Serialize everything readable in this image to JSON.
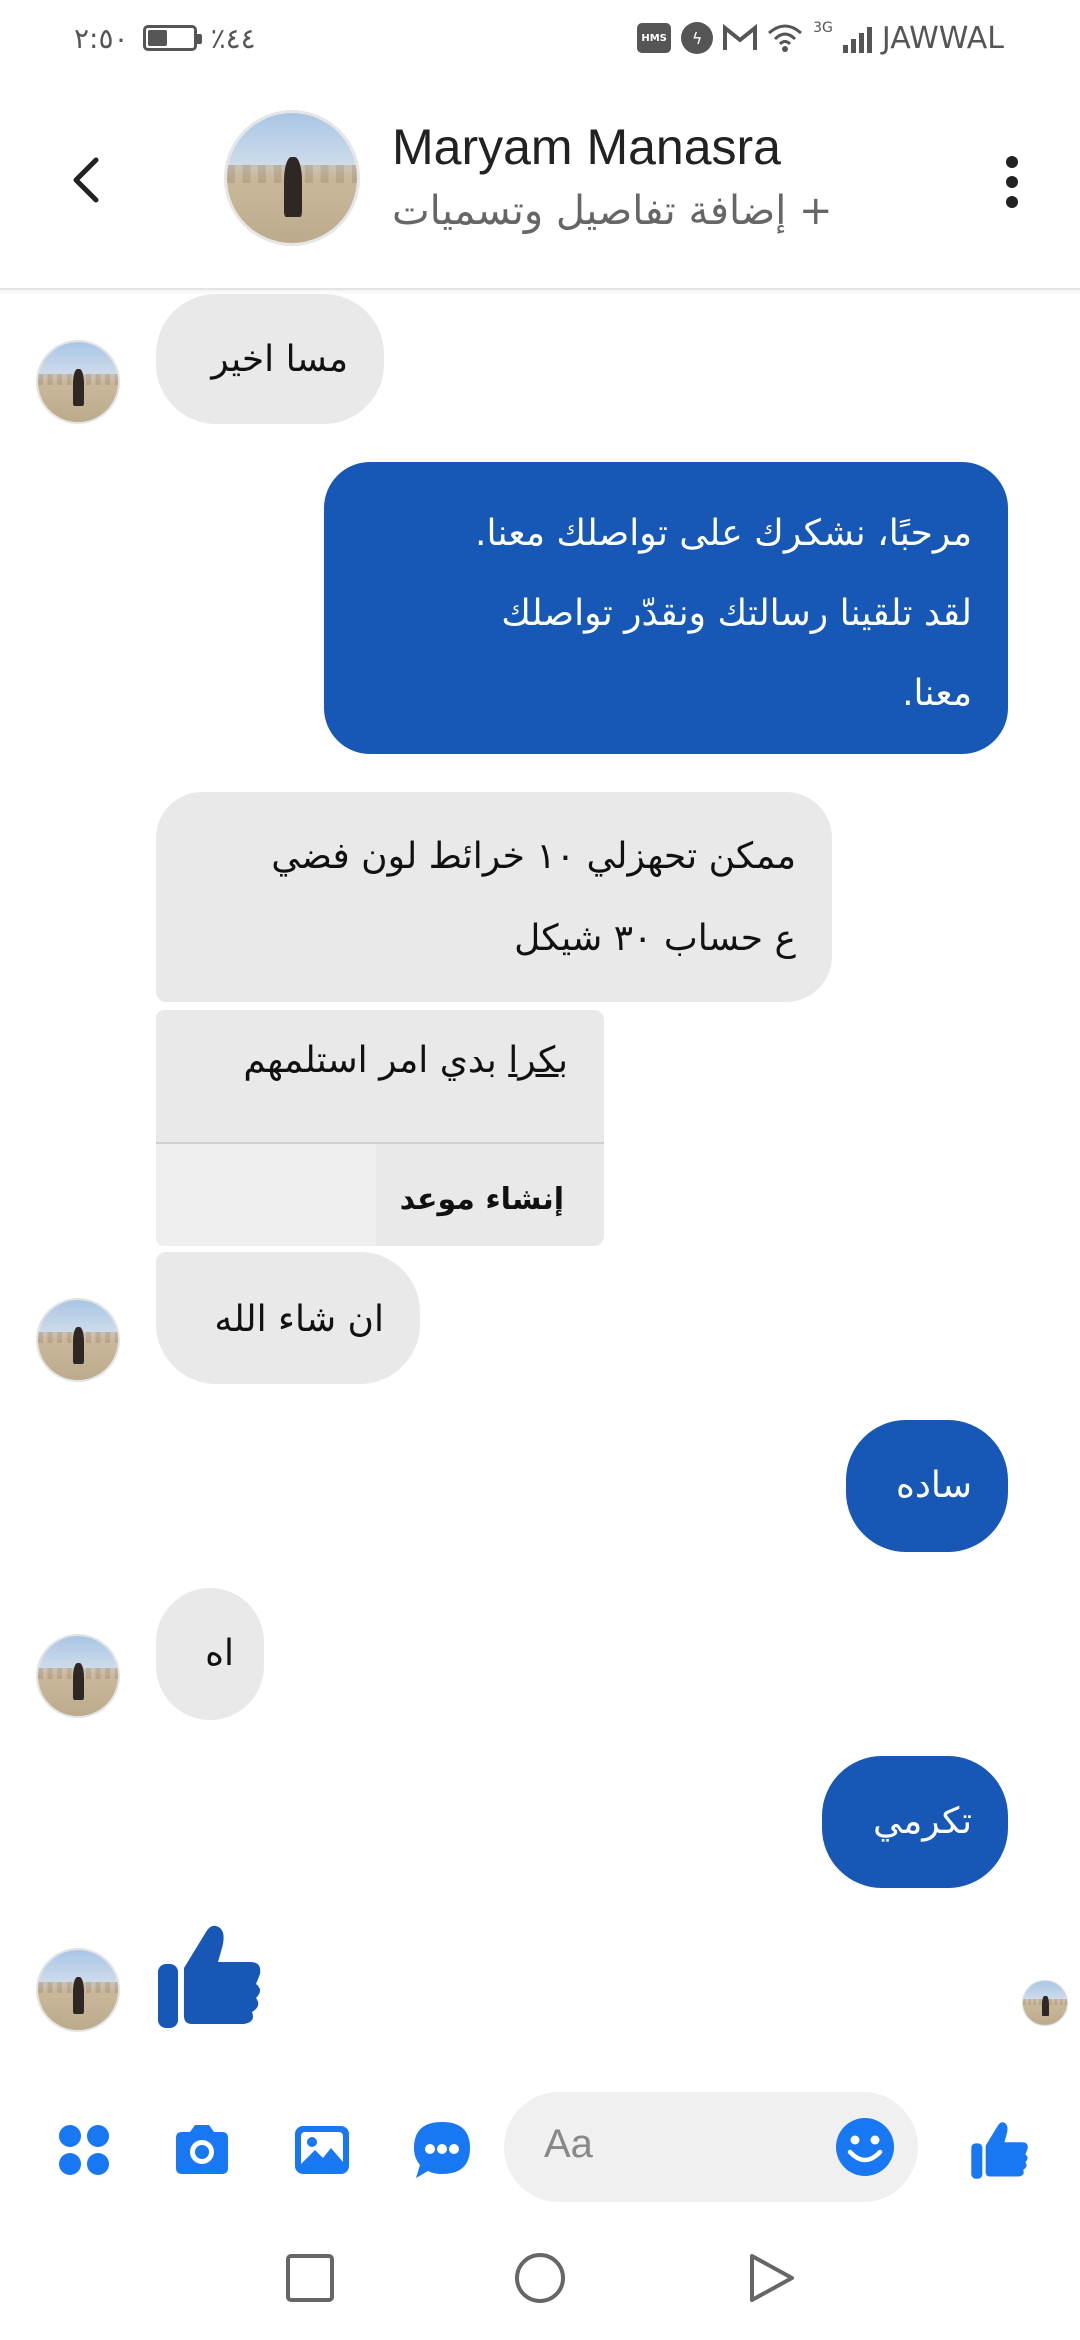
{
  "status_bar": {
    "time": "٢:٥٠",
    "battery_percent": "٪٤٤",
    "battery_level": 0.44,
    "network_type": "3G",
    "carrier": "JAWWAL",
    "icons": [
      "hms-icon",
      "messenger-icon",
      "gmail-icon",
      "wifi-icon",
      "signal-icon"
    ]
  },
  "header": {
    "contact_name": "Maryam Manasra",
    "subtitle": "+ إضافة تفاصيل وتسميات"
  },
  "messages": [
    {
      "direction": "in",
      "text": "مسا اخير"
    },
    {
      "direction": "out",
      "lines": [
        "مرحبًا، نشكرك على تواصلك معنا.",
        "لقد تلقينا رسالتك ونقدّر تواصلك",
        "معنا."
      ]
    },
    {
      "direction": "in",
      "lines": [
        "ممكن تحهزلي ١٠ خرائط لون فضي",
        "ع حساب ٣٠ شيكل"
      ]
    },
    {
      "direction": "in",
      "card": true,
      "underlined": "بكرا",
      "rest": " بدي امر استلمهم",
      "action": "إنشاء موعد"
    },
    {
      "direction": "in",
      "text": "ان شاء الله"
    },
    {
      "direction": "out",
      "text": "ساده"
    },
    {
      "direction": "in",
      "text": "اه"
    },
    {
      "direction": "out",
      "text": "تكرمي"
    },
    {
      "direction": "in",
      "like": true
    }
  ],
  "input": {
    "placeholder": "Aa",
    "icons": [
      "apps-icon",
      "camera-icon",
      "gallery-icon",
      "chat-bubble-icon",
      "emoji-icon",
      "like-icon"
    ]
  },
  "nav": [
    "recent-apps-button",
    "home-button",
    "back-button"
  ],
  "colors": {
    "accent": "#1757b5",
    "icon_blue": "#1877f2",
    "incoming_bubble": "#e9e9e9"
  }
}
